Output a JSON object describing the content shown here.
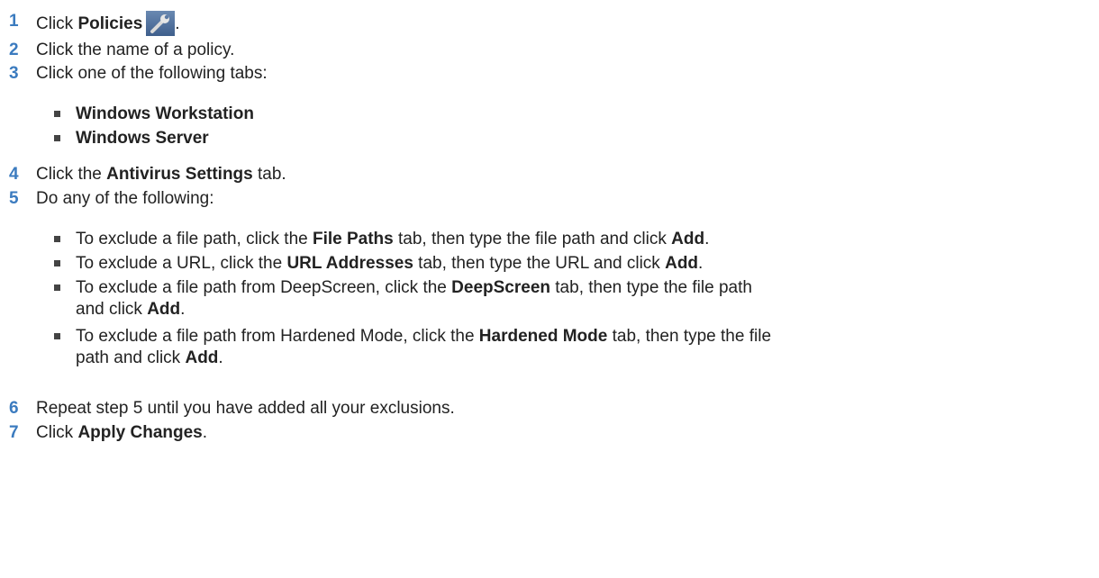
{
  "steps": [
    {
      "num": "1",
      "pre": "Click ",
      "bold": "Policies",
      "post": "."
    },
    {
      "num": "2",
      "text": "Click the name of a policy."
    },
    {
      "num": "3",
      "text": "Click one of the following tabs:"
    },
    {
      "num": "4",
      "pre": "Click the ",
      "bold": "Antivirus Settings",
      "post": " tab."
    },
    {
      "num": "5",
      "text": "Do any of the following:"
    },
    {
      "num": "6",
      "text": "Repeat step 5 until you have added all your exclusions."
    },
    {
      "num": "7",
      "pre": "Click ",
      "bold": "Apply Changes",
      "post": "."
    }
  ],
  "step3_bullets": [
    "Windows Workstation",
    "Windows Server"
  ],
  "step5_bullets": [
    {
      "a": "To exclude a file path, click the ",
      "b": "File Paths",
      "c": " tab, then type the file path and click ",
      "d": "Add",
      "e": "."
    },
    {
      "a": "To exclude a URL, click the ",
      "b": "URL Addresses",
      "c": " tab, then type the URL and click ",
      "d": "Add",
      "e": "."
    },
    {
      "a": "To exclude a file path from DeepScreen, click the ",
      "b": "DeepScreen",
      "c": " tab, then type the file path",
      "line2a": "and click ",
      "d": "Add",
      "e": "."
    },
    {
      "a": "To exclude a file path from Hardened Mode, click the ",
      "b": "Hardened Mode",
      "c": " tab, then type the file",
      "line2a": "path and click ",
      "d": "Add",
      "e": "."
    }
  ],
  "icons": {
    "policies": "wrench-icon"
  },
  "colors": {
    "step_number": "#3b7bbf",
    "bullet": "#444444",
    "icon_bg": "#4f6f9c"
  }
}
